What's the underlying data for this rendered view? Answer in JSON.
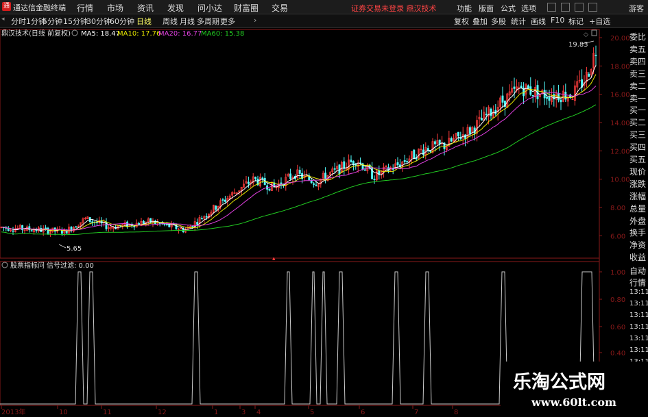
{
  "app": {
    "title": "通达信金融终端",
    "logo": "通"
  },
  "menu": [
    "行情",
    "市场",
    "资讯",
    "发现",
    "问小达",
    "财富圈",
    "交易"
  ],
  "login_status": "证券交易未登录  鼎汉技术",
  "right_menu": [
    "功能",
    "版面",
    "公式",
    "选项"
  ],
  "guest": "游客",
  "periods": [
    "分时",
    "1分钟",
    "5分钟",
    "15分钟",
    "30分钟",
    "60分钟",
    "日线",
    "周线",
    "月线",
    "多周期",
    "更多"
  ],
  "active_period": "日线",
  "tools": [
    "复权",
    "叠加",
    "多股",
    "统计",
    "画线",
    "F10",
    "标记",
    "+自选"
  ],
  "main_chart": {
    "stock": "鼎汉技术(日线 前复权)",
    "ma": [
      {
        "label": "MA5: 18.47",
        "color": "#ffffff"
      },
      {
        "label": "MA10: 17.76",
        "color": "#e8e800"
      },
      {
        "label": "MA20: 16.77",
        "color": "#e040e0"
      },
      {
        "label": "MA60: 15.38",
        "color": "#22cc22"
      }
    ],
    "high_label": "19.83",
    "low_label": "5.65",
    "y_ticks": [
      "20.00",
      "18.00",
      "16.00",
      "14.00",
      "12.00",
      "10.00",
      "8.00",
      "6.00"
    ]
  },
  "sub_chart": {
    "title": "股票指标问",
    "signal": "信号过滤: 0.00",
    "y_ticks": [
      "1.00",
      "0.80",
      "0.60",
      "0.40"
    ]
  },
  "x_axis": [
    "2013年",
    "10",
    "11",
    "12",
    "1",
    "3",
    "4",
    "5",
    "6",
    "7",
    "8"
  ],
  "right_panel": [
    "委比",
    "卖五",
    "卖四",
    "卖三",
    "卖二",
    "卖一",
    "买一",
    "买二",
    "买三",
    "买四",
    "买五",
    "现价",
    "涨跌",
    "涨幅",
    "总量",
    "外盘",
    "换手",
    "净资",
    "收益"
  ],
  "right_panel_lower": [
    "自动",
    "行情",
    "13:11",
    "13:11",
    "13:11",
    "13:11",
    "13:11",
    "13:11",
    "13:11",
    "13:11"
  ],
  "watermark": {
    "cn": "乐淘公式网",
    "url": "www.60lt.com"
  },
  "colors": {
    "up": "#ff3c3c",
    "down": "#54ffff",
    "grid": "#8b1a1a",
    "signal": "#cccccc"
  }
}
